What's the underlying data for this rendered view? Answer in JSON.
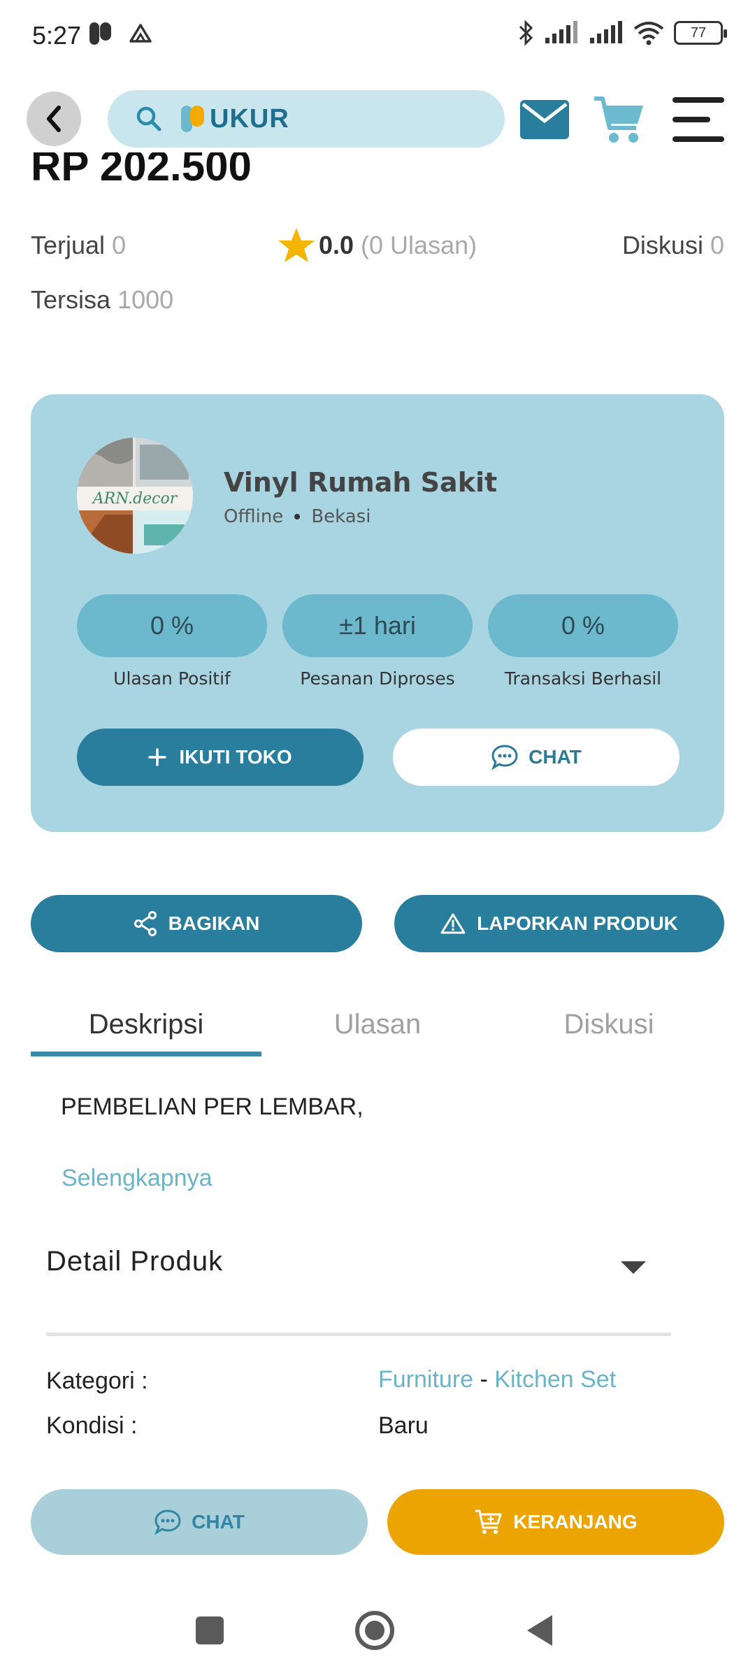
{
  "status": {
    "time": "5:27",
    "battery": "77"
  },
  "header": {
    "logo_text": "UKUR",
    "icons": [
      "back-arrow-icon",
      "search-icon",
      "mail-icon",
      "cart-icon",
      "menu-icon"
    ]
  },
  "product": {
    "price": "RP 202.500",
    "sold_label": "Terjual",
    "sold_value": "0",
    "rating": "0.0",
    "reviews": "(0 Ulasan)",
    "discussion_label": "Diskusi",
    "discussion_value": "0",
    "remaining_label": "Tersisa",
    "remaining_value": "1000"
  },
  "store": {
    "name": "Vinyl Rumah Sakit",
    "status": "Offline",
    "location": "Bekasi",
    "metrics": [
      {
        "value": "0 %",
        "label": "Ulasan Positif"
      },
      {
        "value": "±1 hari",
        "label": "Pesanan Diproses"
      },
      {
        "value": "0 %",
        "label": "Transaksi Berhasil"
      }
    ],
    "follow_label": "IKUTI TOKO",
    "chat_label": "CHAT"
  },
  "actions": {
    "share_label": "BAGIKAN",
    "report_label": "LAPORKAN PRODUK"
  },
  "tabs": [
    {
      "label": "Deskripsi",
      "active": true
    },
    {
      "label": "Ulasan",
      "active": false
    },
    {
      "label": "Diskusi",
      "active": false
    }
  ],
  "description": {
    "text": "PEMBELIAN PER LEMBAR,",
    "more_link": "Selengkapnya"
  },
  "detail": {
    "title": "Detail Produk",
    "category_label": "Kategori :",
    "category_main": "Furniture",
    "category_sep": " - ",
    "category_sub": "Kitchen Set",
    "condition_label": "Kondisi :",
    "condition_value": "Baru"
  },
  "bottom_bar": {
    "chat_label": "CHAT",
    "cart_label": "KERANJANG"
  },
  "colors": {
    "primary": "#287e9c",
    "card": "#a8d5e1",
    "accent": "#eca402",
    "link": "#6bb3c8"
  }
}
